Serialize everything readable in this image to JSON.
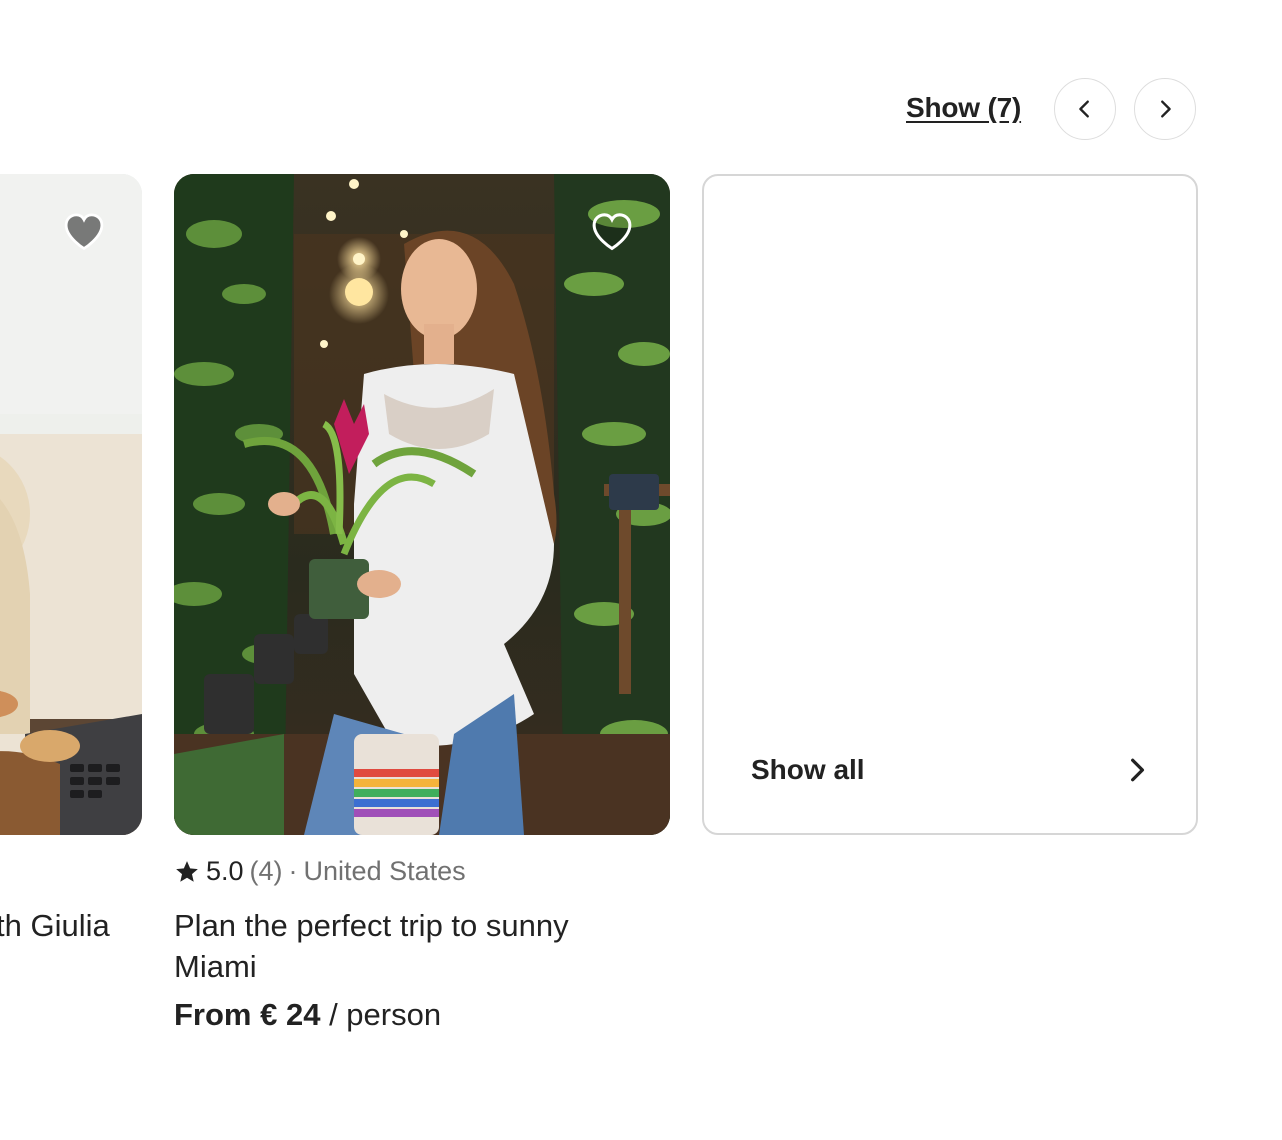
{
  "header": {
    "show_label": "Show (7)",
    "prev_button_icon": "chevron-left-icon",
    "next_button_icon": "chevron-right-icon"
  },
  "cards": [
    {
      "title_fragment": "th Giulia",
      "wishlist_icon": "heart-icon",
      "wishlisted_style": "filled-gray"
    },
    {
      "rating": "5.0",
      "reviews": "(4)",
      "separator": "·",
      "location": "United States",
      "title": "Plan the perfect trip to sunny Miami",
      "price_prefix": "From € 24",
      "price_suffix": "/ person",
      "wishlist_icon": "heart-icon",
      "rating_icon": "star-icon"
    }
  ],
  "show_all": {
    "label": "Show all",
    "icon": "chevron-right-icon"
  },
  "colors": {
    "text": "#222222",
    "muted": "#717171",
    "border": "#dddddd"
  }
}
